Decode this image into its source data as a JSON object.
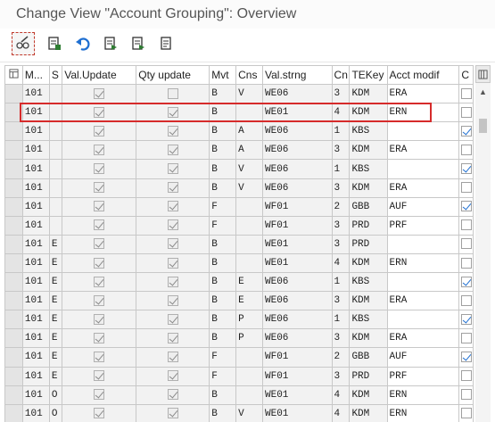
{
  "window": {
    "title": "Change View \"Account Grouping\": Overview"
  },
  "toolbar": {
    "buttons": [
      {
        "name": "display-change-button",
        "icon": "glasses-pencil-icon"
      },
      {
        "name": "select-button",
        "icon": "select-list-icon"
      },
      {
        "name": "undo-button",
        "icon": "undo-icon"
      },
      {
        "name": "export-button",
        "icon": "document-export-icon"
      },
      {
        "name": "print-button",
        "icon": "document-print-icon"
      },
      {
        "name": "info-button",
        "icon": "document-info-icon"
      }
    ]
  },
  "table": {
    "headers": [
      "M...",
      "S",
      "Val.Update",
      "Qty update",
      "Mvt",
      "Cns",
      "Val.strng",
      "Cn",
      "TEKey",
      "Acct modif",
      "C"
    ],
    "rows": [
      {
        "m": "101",
        "s": "",
        "val_update": true,
        "qty_update": false,
        "mvt": "B",
        "cns": "V",
        "val_strng": "WE06",
        "cn": "3",
        "tekey": "KDM",
        "acct_modif": "ERA",
        "c": false
      },
      {
        "m": "101",
        "s": "",
        "val_update": true,
        "qty_update": true,
        "mvt": "B",
        "cns": "",
        "val_strng": "WE01",
        "cn": "4",
        "tekey": "KDM",
        "acct_modif": "ERN",
        "c": false
      },
      {
        "m": "101",
        "s": "",
        "val_update": true,
        "qty_update": true,
        "mvt": "B",
        "cns": "A",
        "val_strng": "WE06",
        "cn": "1",
        "tekey": "KBS",
        "acct_modif": "",
        "c": true
      },
      {
        "m": "101",
        "s": "",
        "val_update": true,
        "qty_update": true,
        "mvt": "B",
        "cns": "A",
        "val_strng": "WE06",
        "cn": "3",
        "tekey": "KDM",
        "acct_modif": "ERA",
        "c": false
      },
      {
        "m": "101",
        "s": "",
        "val_update": true,
        "qty_update": true,
        "mvt": "B",
        "cns": "V",
        "val_strng": "WE06",
        "cn": "1",
        "tekey": "KBS",
        "acct_modif": "",
        "c": true
      },
      {
        "m": "101",
        "s": "",
        "val_update": true,
        "qty_update": true,
        "mvt": "B",
        "cns": "V",
        "val_strng": "WE06",
        "cn": "3",
        "tekey": "KDM",
        "acct_modif": "ERA",
        "c": false
      },
      {
        "m": "101",
        "s": "",
        "val_update": true,
        "qty_update": true,
        "mvt": "F",
        "cns": "",
        "val_strng": "WF01",
        "cn": "2",
        "tekey": "GBB",
        "acct_modif": "AUF",
        "c": true
      },
      {
        "m": "101",
        "s": "",
        "val_update": true,
        "qty_update": true,
        "mvt": "F",
        "cns": "",
        "val_strng": "WF01",
        "cn": "3",
        "tekey": "PRD",
        "acct_modif": "PRF",
        "c": false
      },
      {
        "m": "101",
        "s": "E",
        "val_update": true,
        "qty_update": true,
        "mvt": "B",
        "cns": "",
        "val_strng": "WE01",
        "cn": "3",
        "tekey": "PRD",
        "acct_modif": "",
        "c": false
      },
      {
        "m": "101",
        "s": "E",
        "val_update": true,
        "qty_update": true,
        "mvt": "B",
        "cns": "",
        "val_strng": "WE01",
        "cn": "4",
        "tekey": "KDM",
        "acct_modif": "ERN",
        "c": false
      },
      {
        "m": "101",
        "s": "E",
        "val_update": true,
        "qty_update": true,
        "mvt": "B",
        "cns": "E",
        "val_strng": "WE06",
        "cn": "1",
        "tekey": "KBS",
        "acct_modif": "",
        "c": true
      },
      {
        "m": "101",
        "s": "E",
        "val_update": true,
        "qty_update": true,
        "mvt": "B",
        "cns": "E",
        "val_strng": "WE06",
        "cn": "3",
        "tekey": "KDM",
        "acct_modif": "ERA",
        "c": false
      },
      {
        "m": "101",
        "s": "E",
        "val_update": true,
        "qty_update": true,
        "mvt": "B",
        "cns": "P",
        "val_strng": "WE06",
        "cn": "1",
        "tekey": "KBS",
        "acct_modif": "",
        "c": true
      },
      {
        "m": "101",
        "s": "E",
        "val_update": true,
        "qty_update": true,
        "mvt": "B",
        "cns": "P",
        "val_strng": "WE06",
        "cn": "3",
        "tekey": "KDM",
        "acct_modif": "ERA",
        "c": false
      },
      {
        "m": "101",
        "s": "E",
        "val_update": true,
        "qty_update": true,
        "mvt": "F",
        "cns": "",
        "val_strng": "WF01",
        "cn": "2",
        "tekey": "GBB",
        "acct_modif": "AUF",
        "c": true
      },
      {
        "m": "101",
        "s": "E",
        "val_update": true,
        "qty_update": true,
        "mvt": "F",
        "cns": "",
        "val_strng": "WF01",
        "cn": "3",
        "tekey": "PRD",
        "acct_modif": "PRF",
        "c": false
      },
      {
        "m": "101",
        "s": "O",
        "val_update": true,
        "qty_update": true,
        "mvt": "B",
        "cns": "",
        "val_strng": "WE01",
        "cn": "4",
        "tekey": "KDM",
        "acct_modif": "ERN",
        "c": false
      },
      {
        "m": "101",
        "s": "O",
        "val_update": true,
        "qty_update": true,
        "mvt": "B",
        "cns": "V",
        "val_strng": "WE01",
        "cn": "4",
        "tekey": "KDM",
        "acct_modif": "ERN",
        "c": false
      }
    ]
  },
  "highlight": {
    "row_index": 1,
    "color": "#d62b2b"
  },
  "colors": {
    "accent": "#1f6fd1",
    "highlight": "#d62b2b"
  }
}
